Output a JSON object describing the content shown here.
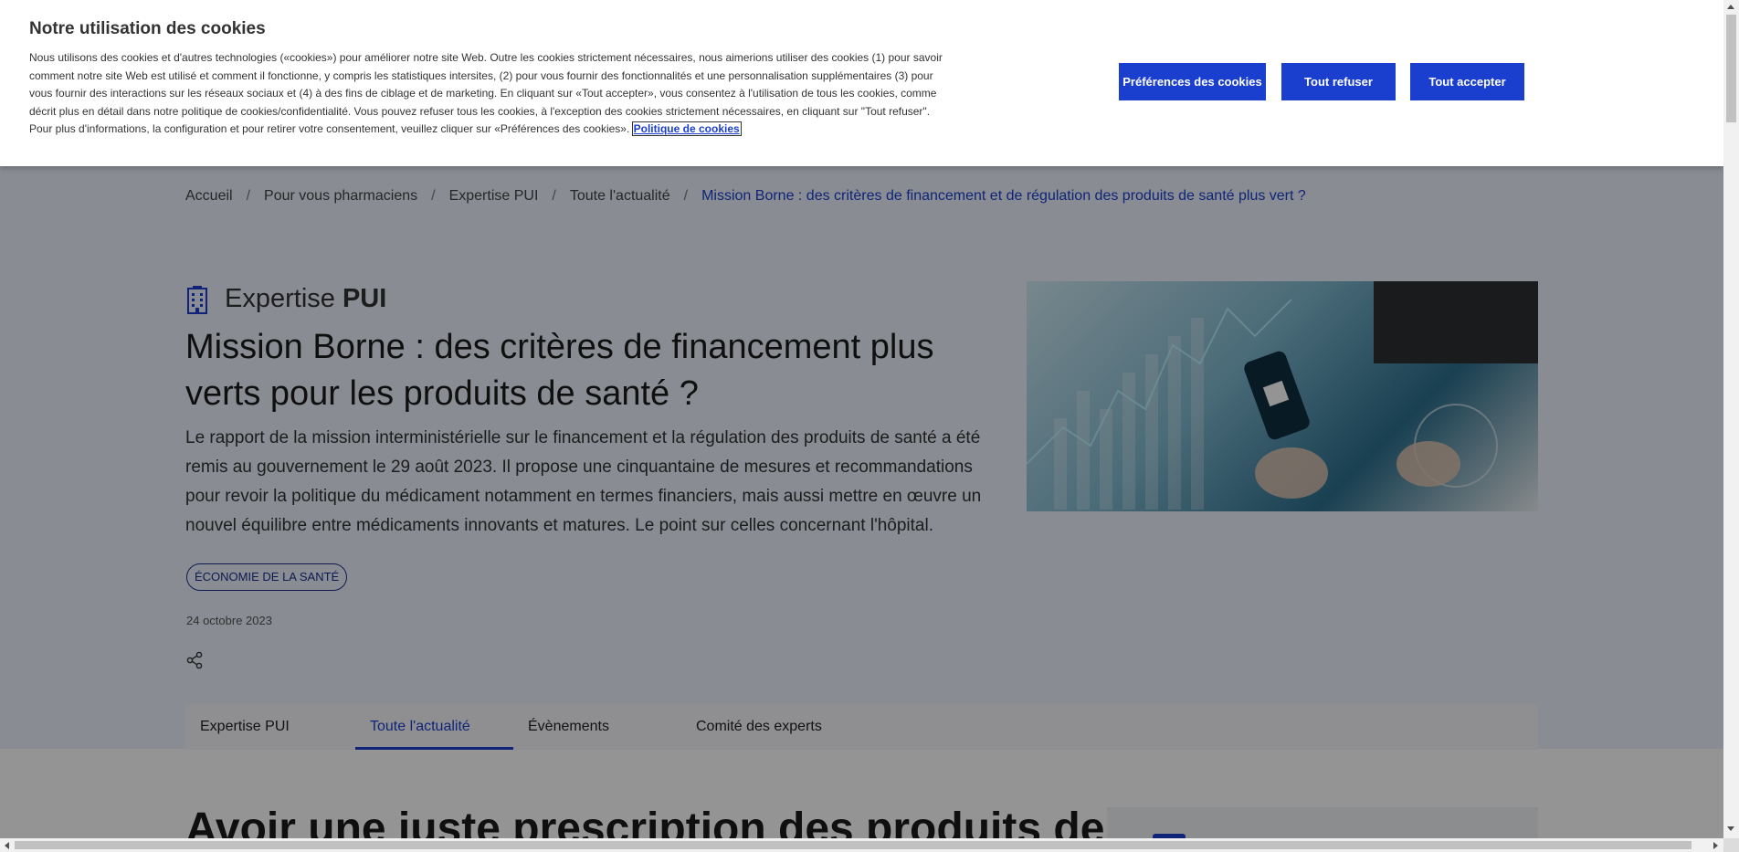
{
  "cookie_banner": {
    "title": "Notre utilisation des cookies",
    "text": "Nous utilisons des cookies et d'autres technologies («cookies») pour améliorer notre site Web. Outre les cookies strictement nécessaires, nous aimerions utiliser des cookies (1) pour savoir comment notre site Web est utilisé et comment il fonctionne, y compris les statistiques intersites, (2) pour vous fournir des fonctionnalités et une personnalisation supplémentaires (3) pour vous fournir des interactions sur les réseaux sociaux et (4) à des fins de ciblage et de marketing. En cliquant sur «Tout accepter», vous consentez à l'utilisation de tous les cookies, comme décrit plus en détail dans notre politique de cookies/confidentialité. Vous pouvez refuser tous les cookies, à l'exception des cookies strictement nécessaires, en cliquant sur \"Tout refuser\". Pour plus d'informations, la configuration et pour retirer votre consentement, veuillez cliquer sur «Préférences des cookies».",
    "policy_link": "Politique de cookies",
    "buttons": {
      "preferences": "Préférences des cookies",
      "refuse": "Tout refuser",
      "accept": "Tout accepter"
    },
    "accent_color": "#1a3fcf"
  },
  "breadcrumb": {
    "items": [
      "Accueil",
      "Pour vous pharmaciens",
      "Expertise PUI",
      "Toute l'actualité"
    ],
    "current": "Mission Borne : des critères de financement et de régulation des produits de santé plus vert ?",
    "separator": "/"
  },
  "article": {
    "category_prefix": "Expertise",
    "category_name": "PUI",
    "category_icon": "building-icon",
    "title": "Mission Borne : des critères de financement plus verts pour les produits de santé ?",
    "lead": "Le rapport de la mission interministérielle sur le financement et la régulation des produits de santé a été remis au gouvernement le 29 août 2023. Il propose une cinquantaine de mesures et recommandations pour revoir la politique du médicament notamment en termes financiers, mais aussi mettre en œuvre un nouvel équilibre entre médicaments innovants et matures. Le point sur celles concernant l'hôpital.",
    "tag": "ÉCONOMIE DE LA SANTÉ",
    "date": "24 octobre 2023",
    "share_icon": "share-icon"
  },
  "tabs": [
    {
      "label": "Expertise PUI",
      "active": false
    },
    {
      "label": "Toute l'actualité",
      "active": true
    },
    {
      "label": "Évènements",
      "active": false
    },
    {
      "label": "Comité des experts",
      "active": false
    }
  ],
  "section": {
    "title": "Avoir une juste prescription des produits de santé"
  }
}
